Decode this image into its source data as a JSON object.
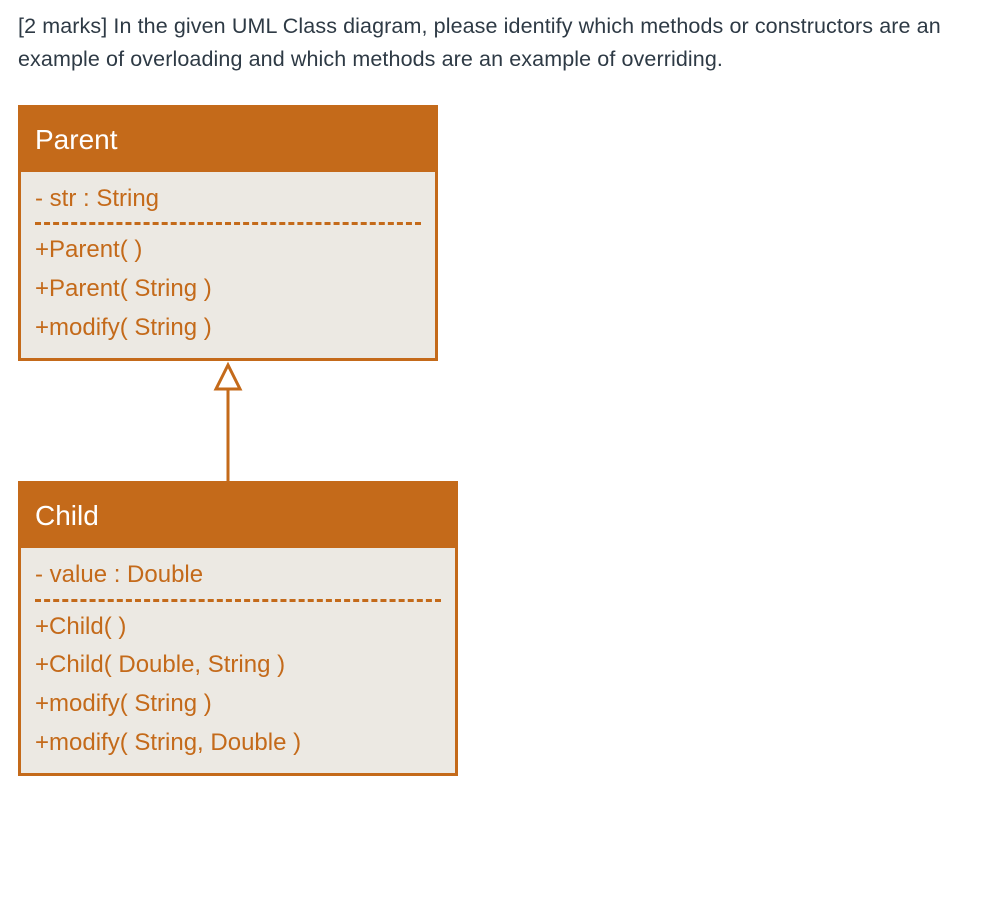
{
  "question": {
    "text": "[2 marks] In the given UML Class diagram, please identify which methods or constructors are an example of overloading and which methods are an example of overriding."
  },
  "colors": {
    "brand": "#c46a1a",
    "body_bg": "#ece9e3",
    "text_dark": "#2e3a45"
  },
  "diagram": {
    "relationship": "generalization",
    "classes": [
      {
        "name": "Parent",
        "attributes": [
          {
            "visibility": "-",
            "name": "str",
            "type": "String",
            "display": "- str : String"
          }
        ],
        "operations": [
          {
            "visibility": "+",
            "signature": "Parent( )",
            "display": "+Parent( )"
          },
          {
            "visibility": "+",
            "signature": "Parent( String )",
            "display": "+Parent( String )"
          },
          {
            "visibility": "+",
            "signature": "modify( String )",
            "display": "+modify( String )"
          }
        ]
      },
      {
        "name": "Child",
        "attributes": [
          {
            "visibility": "-",
            "name": "value",
            "type": "Double",
            "display": "- value : Double"
          }
        ],
        "operations": [
          {
            "visibility": "+",
            "signature": "Child( )",
            "display": "+Child( )"
          },
          {
            "visibility": "+",
            "signature": "Child( Double, String )",
            "display": "+Child( Double, String )"
          },
          {
            "visibility": "+",
            "signature": "modify( String )",
            "display": "+modify( String )"
          },
          {
            "visibility": "+",
            "signature": "modify( String, Double )",
            "display": "+modify( String, Double )"
          }
        ]
      }
    ]
  }
}
